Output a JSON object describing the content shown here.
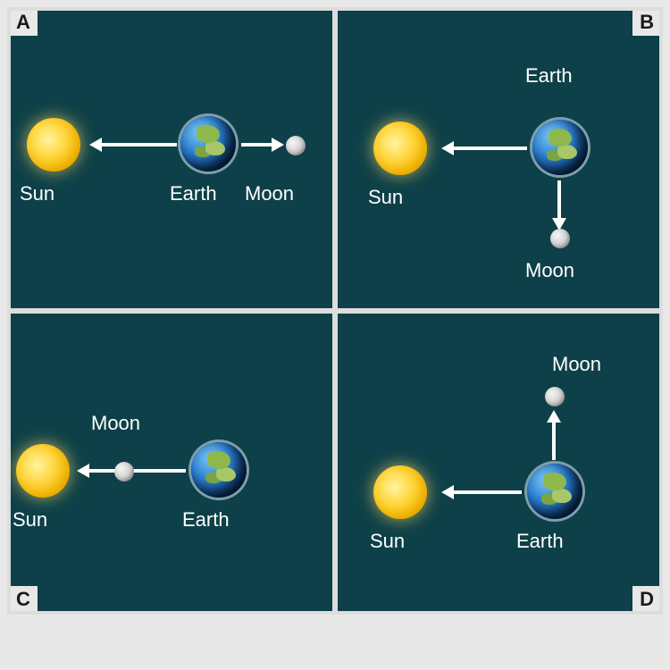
{
  "panels": {
    "a": {
      "label": "A",
      "sun": "Sun",
      "earth": "Earth",
      "moon": "Moon"
    },
    "b": {
      "label": "B",
      "sun": "Sun",
      "earth": "Earth",
      "moon": "Moon"
    },
    "c": {
      "label": "C",
      "sun": "Sun",
      "earth": "Earth",
      "moon": "Moon"
    },
    "d": {
      "label": "D",
      "sun": "Sun",
      "earth": "Earth",
      "moon": "Moon"
    }
  },
  "diagram": {
    "bodies": [
      "Sun",
      "Earth",
      "Moon"
    ],
    "arrangements": [
      {
        "panel": "A",
        "order_left_to_right": [
          "Sun",
          "Earth",
          "Moon"
        ],
        "arrows": [
          [
            "Earth",
            "Sun"
          ],
          [
            "Earth",
            "Moon"
          ]
        ]
      },
      {
        "panel": "B",
        "positions": {
          "Sun": "left",
          "Earth": "right",
          "Moon": "below-earth"
        },
        "arrows": [
          [
            "Earth",
            "Sun"
          ],
          [
            "Earth",
            "Moon"
          ]
        ]
      },
      {
        "panel": "C",
        "order_left_to_right": [
          "Sun",
          "Moon",
          "Earth"
        ],
        "arrows": [
          [
            "Earth",
            "Sun"
          ]
        ]
      },
      {
        "panel": "D",
        "positions": {
          "Sun": "left",
          "Earth": "right",
          "Moon": "above-earth"
        },
        "arrows": [
          [
            "Earth",
            "Sun"
          ],
          [
            "Earth",
            "Moon"
          ]
        ]
      }
    ]
  }
}
